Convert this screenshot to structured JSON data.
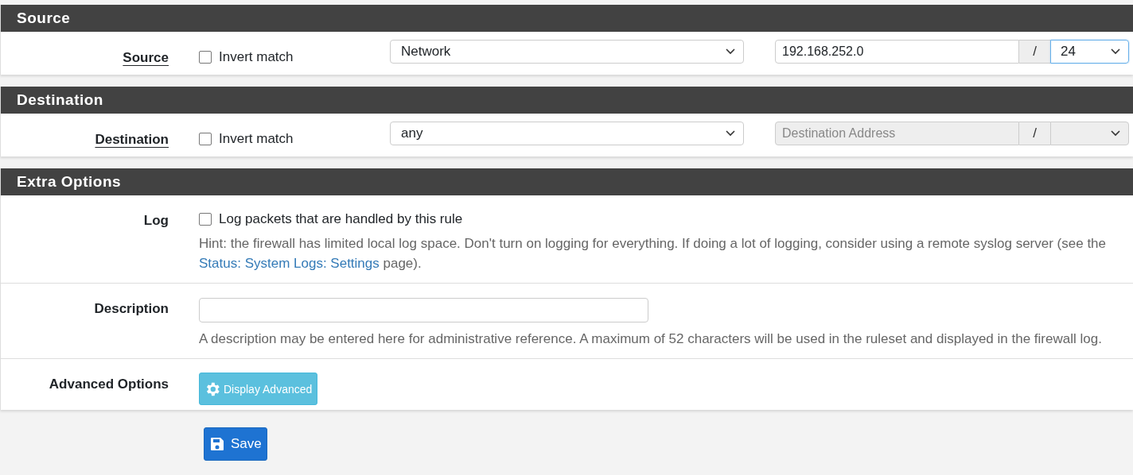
{
  "address_sections": [
    {
      "title": "Source",
      "label": "Source",
      "help": true,
      "invert": {
        "label": "Invert match",
        "checked": false
      },
      "type_select": "Network",
      "address": {
        "value": "192.168.252.0",
        "disabled": false
      },
      "separator": "/",
      "mask": {
        "value": "24",
        "focused": true
      }
    },
    {
      "title": "Destination",
      "label": "Destination",
      "help": true,
      "invert": {
        "label": "Invert match",
        "checked": false
      },
      "type_select": "any",
      "address": {
        "placeholder": "Destination Address",
        "disabled": true
      },
      "separator": "/",
      "mask": {
        "focused": false
      }
    }
  ],
  "extra": {
    "title": "Extra Options",
    "rows": [
      {
        "kind": "checkbox",
        "label": "Log",
        "help": false,
        "checkbox": {
          "label": "Log packets that are handled by this rule",
          "checked": false
        },
        "hint": {
          "before": "Hint: the firewall has limited local log space. Don't turn on logging for everything. If doing a lot of logging, consider using a remote syslog server (see the ",
          "link": "Status: System Logs: Settings",
          "after": " page)."
        }
      },
      {
        "kind": "text",
        "label": "Description",
        "help": false,
        "hint": {
          "before": "A description may be entered here for administrative reference. A maximum of 52 characters will be used in the ruleset and displayed in the firewall log."
        }
      },
      {
        "kind": "button",
        "label": "Advanced Options",
        "help": false,
        "button": "Display Advanced"
      }
    ]
  },
  "save_button": "Save"
}
